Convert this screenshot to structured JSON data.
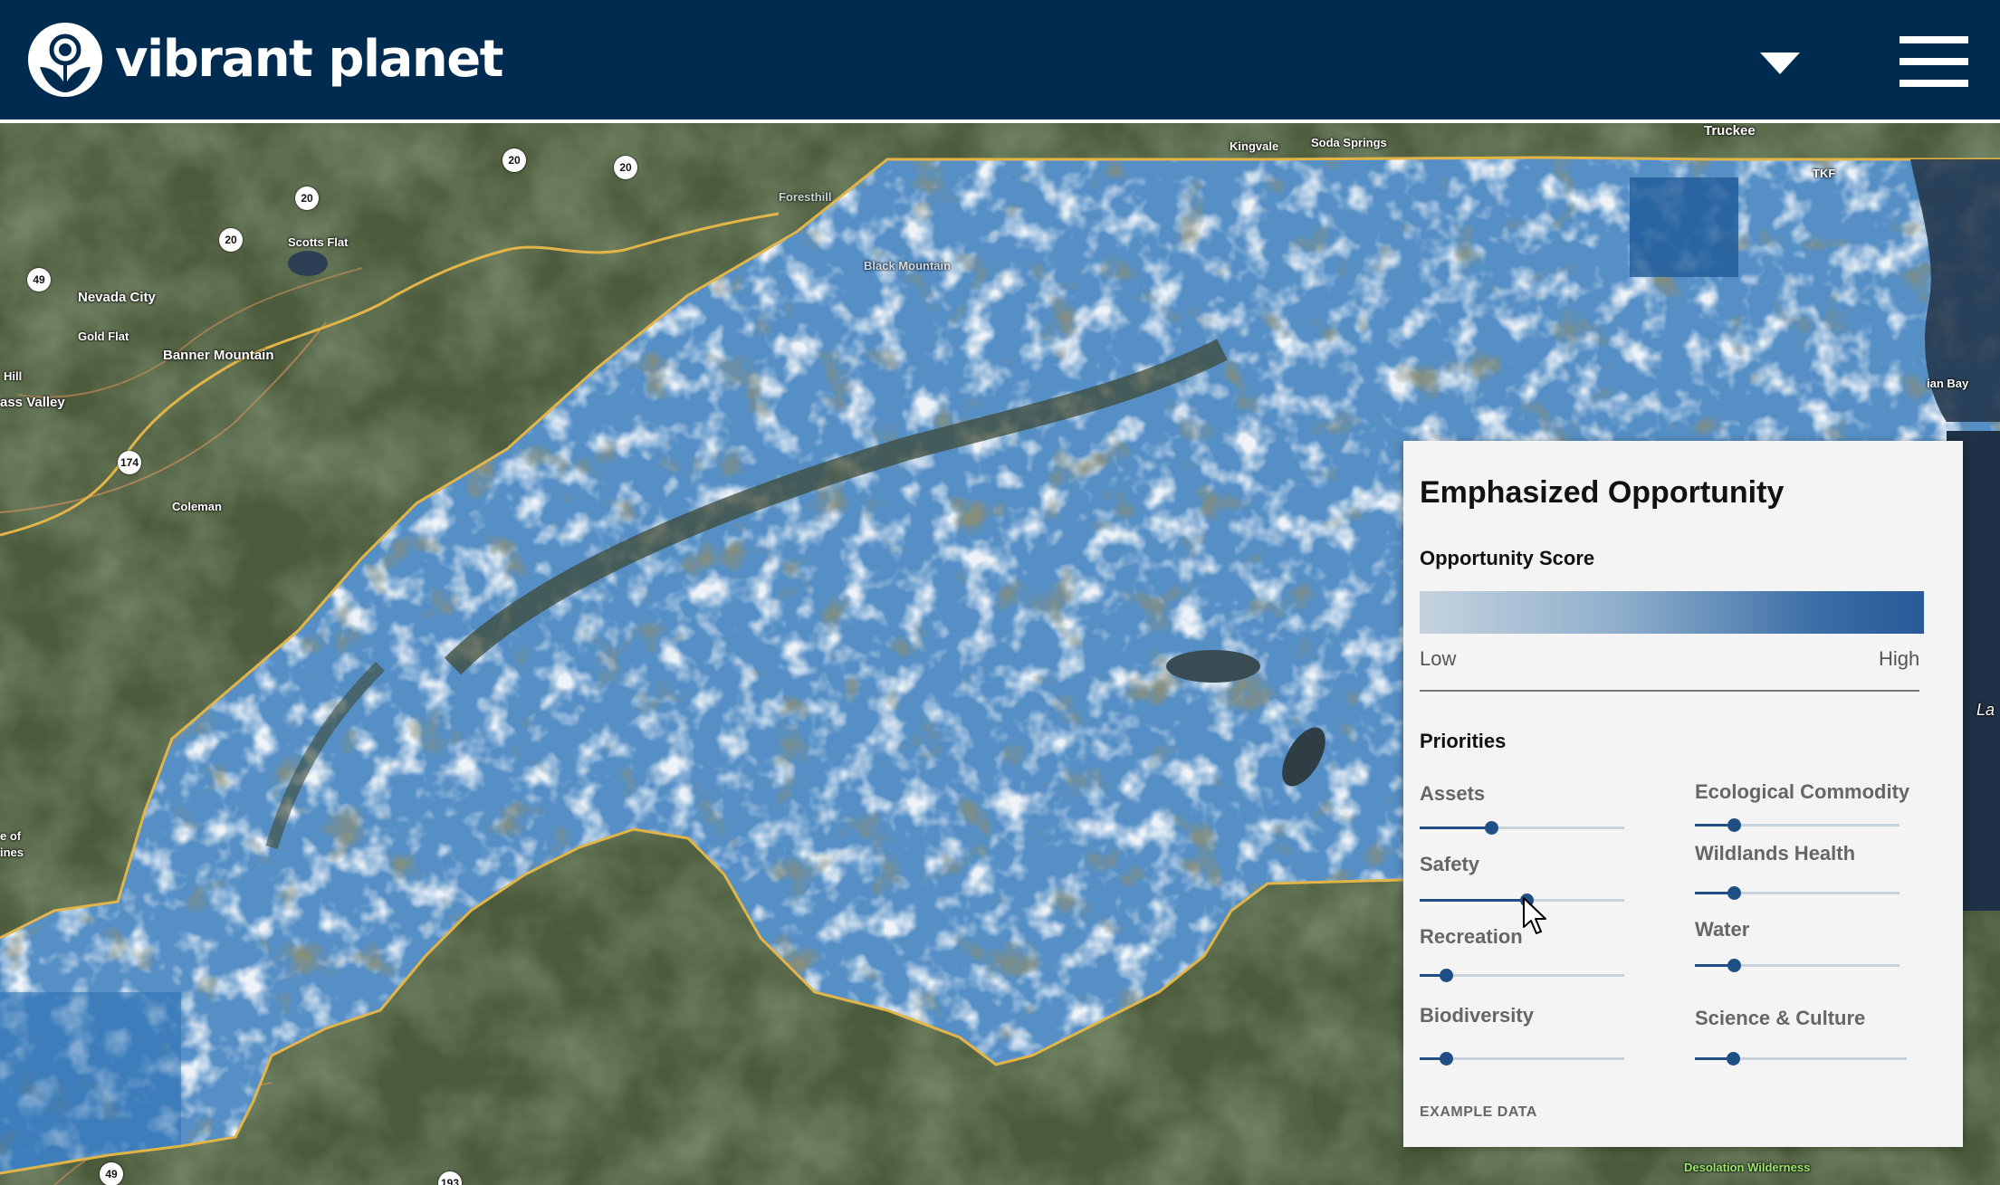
{
  "header": {
    "brand": "vibrant planet",
    "logo_icon": "vibrant-planet-logo-icon",
    "dropdown_icon": "caret-down-icon",
    "menu_icon": "hamburger-menu-icon",
    "background": "#002b50"
  },
  "map": {
    "place_labels": [
      "Kingvale",
      "Soda Springs",
      "Truckee",
      "TKF",
      "Scotts Flat",
      "Nevada City",
      "Gold Flat",
      "Banner Mountain",
      "Hill",
      "ass Valley",
      "Coleman",
      "Desolation Wilderness",
      "ian Bay",
      "e of",
      "ines",
      "La",
      "Black Mountain",
      "Foresthill"
    ],
    "road_shields": [
      "20",
      "20",
      "20",
      "20",
      "49",
      "174",
      "49",
      "193"
    ],
    "boundary_color": "#e3b548",
    "opportunity_color": "#2f6fae"
  },
  "legend": {
    "title": "Emphasized Opportunity",
    "score_label": "Opportunity Score",
    "low": "Low",
    "high": "High",
    "priorities_label": "Priorities",
    "footer": "EXAMPLE DATA",
    "gradient_colors": [
      "#c6d3de",
      "#2a5a97"
    ],
    "sliders": [
      {
        "name": "Assets",
        "value": 0.35
      },
      {
        "name": "Ecological Commodity",
        "value": 0.19
      },
      {
        "name": "Safety",
        "value": 0.52
      },
      {
        "name": "Wildlands Health",
        "value": 0.19
      },
      {
        "name": "Recreation",
        "value": 0.13
      },
      {
        "name": "Water",
        "value": 0.19
      },
      {
        "name": "Biodiversity",
        "value": 0.13
      },
      {
        "name": "Science & Culture",
        "value": 0.18
      }
    ]
  }
}
